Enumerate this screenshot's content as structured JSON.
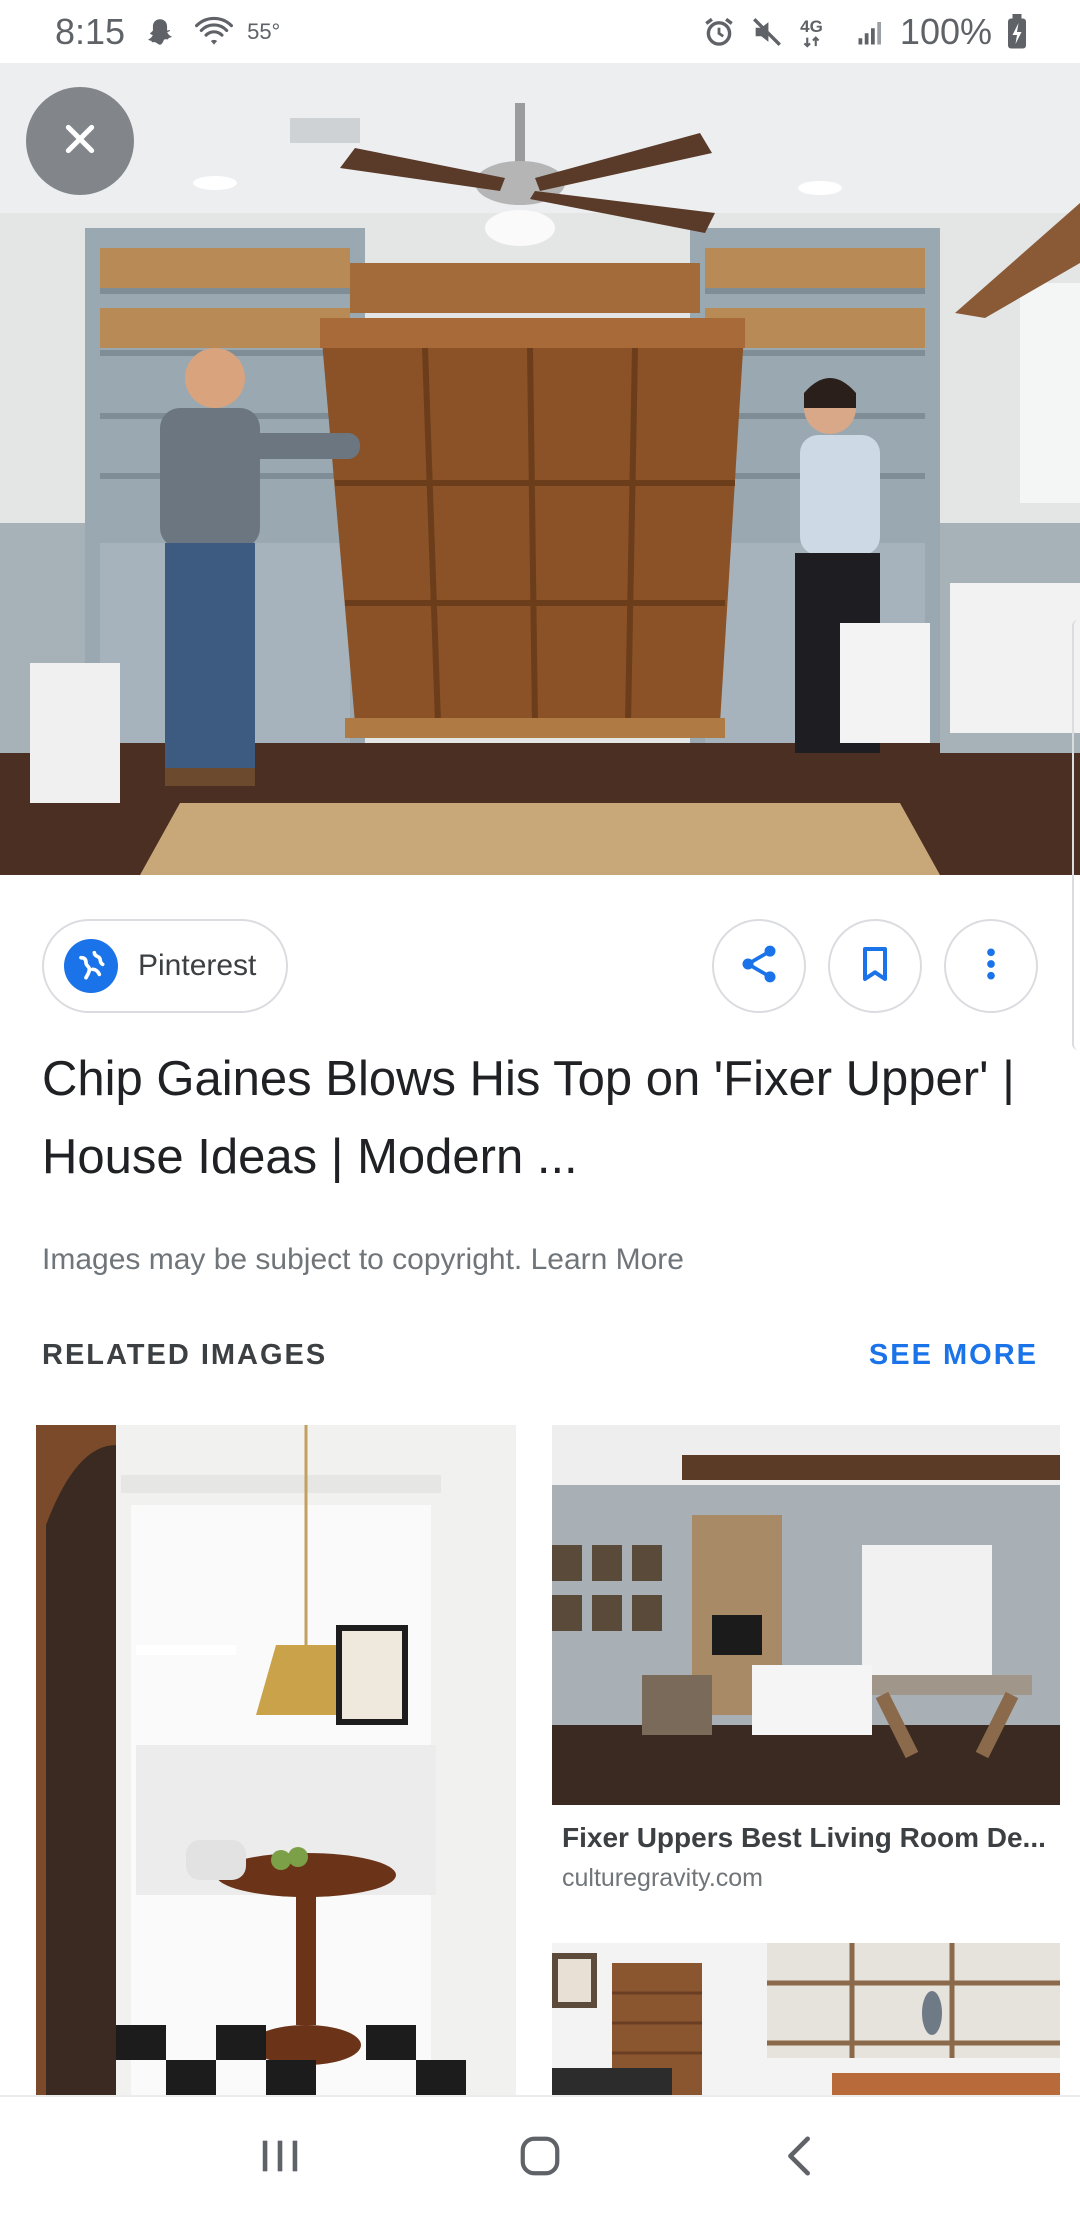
{
  "status_bar": {
    "time": "8:15",
    "temperature": "55°",
    "battery_percent": "100%",
    "network": "4G",
    "icons": [
      "snapchat-icon",
      "wifi-icon",
      "alarm-icon",
      "mute-icon",
      "signal-icon",
      "battery-charging-icon"
    ]
  },
  "hero": {
    "close_icon": "close-icon"
  },
  "source": {
    "name": "Pinterest",
    "icon": "globe-icon"
  },
  "actions": {
    "share_icon": "share-icon",
    "save_icon": "bookmark-icon",
    "more_icon": "more-vert-icon"
  },
  "result": {
    "title": "Chip Gaines Blows His Top on 'Fixer Upper' | House Ideas | Modern ...",
    "copyright": "Images may be subject to copyright. Learn More"
  },
  "related": {
    "header": "RELATED IMAGES",
    "see_more": "SEE MORE",
    "items": [
      {
        "title": "Fixer Uppers Best Living Room De...",
        "domain": "culturegravity.com"
      }
    ]
  },
  "nav": {
    "icons": [
      "recent-apps-icon",
      "home-icon",
      "back-icon"
    ]
  },
  "colors": {
    "accent": "#1a73e8",
    "text_primary": "#202124",
    "text_secondary": "#70757a"
  }
}
